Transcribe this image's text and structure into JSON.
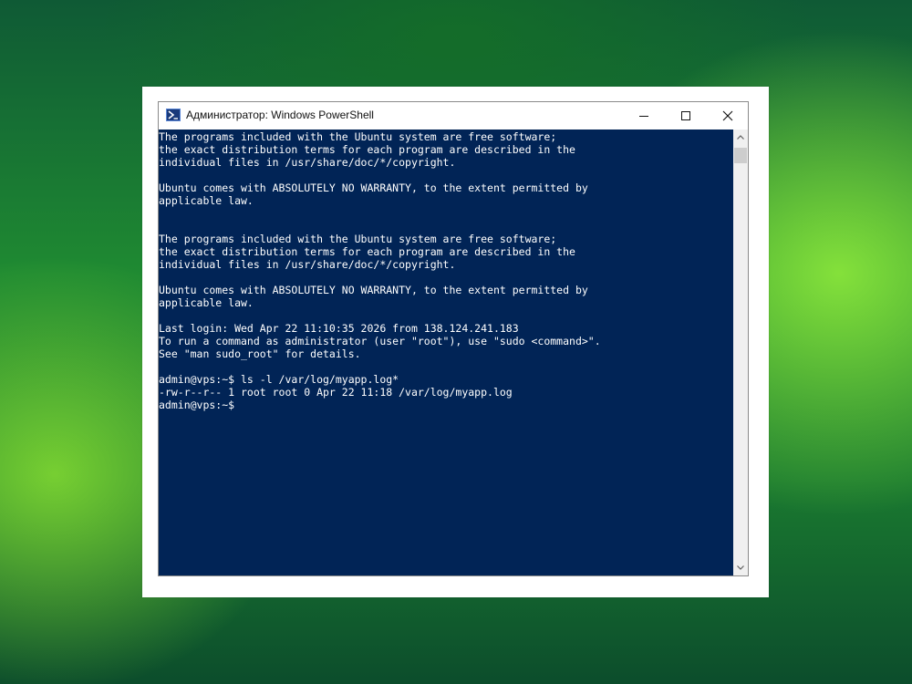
{
  "window": {
    "title": "Администратор: Windows PowerShell",
    "icon": "powershell-icon",
    "controls": [
      "minimize-icon",
      "maximize-icon",
      "close-icon"
    ]
  },
  "terminal": {
    "lines": [
      "The programs included with the Ubuntu system are free software;",
      "the exact distribution terms for each program are described in the",
      "individual files in /usr/share/doc/*/copyright.",
      "",
      "Ubuntu comes with ABSOLUTELY NO WARRANTY, to the extent permitted by",
      "applicable law.",
      "",
      "",
      "The programs included with the Ubuntu system are free software;",
      "the exact distribution terms for each program are described in the",
      "individual files in /usr/share/doc/*/copyright.",
      "",
      "Ubuntu comes with ABSOLUTELY NO WARRANTY, to the extent permitted by",
      "applicable law.",
      "",
      "Last login: Wed Apr 22 11:10:35 2026 from 138.124.241.183",
      "To run a command as administrator (user \"root\"), use \"sudo <command>\".",
      "See \"man sudo_root\" for details.",
      "",
      "admin@vps:~$ ls -l /var/log/myapp.log*",
      "-rw-r--r-- 1 root root 0 Apr 22 11:18 /var/log/myapp.log",
      "admin@vps:~$"
    ]
  },
  "colors": {
    "console_background": "#012456",
    "console_text": "#ffffff",
    "titlebar": "#ffffff"
  }
}
